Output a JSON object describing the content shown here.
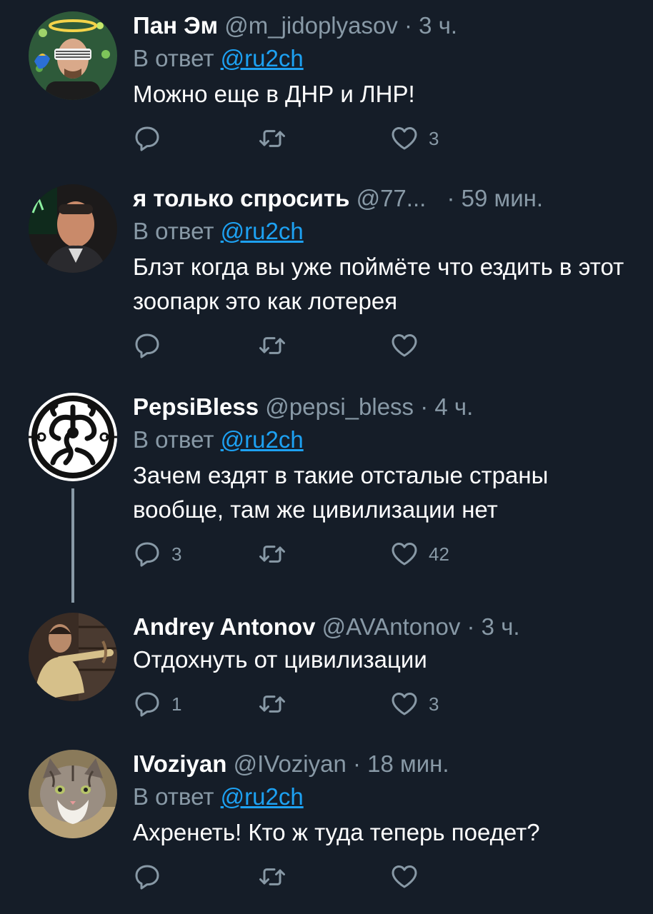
{
  "colors": {
    "background": "#151d28",
    "secondary_text": "#8899a6",
    "link": "#1da1f2",
    "primary_text": "#ffffff"
  },
  "tweets": [
    {
      "name": "Пан Эм",
      "handle": "@m_jidoplyasov",
      "time": "· 3 ч.",
      "reply_prefix": "В ответ",
      "reply_to": "@ru2ch",
      "text": "Можно еще в ДНР и ЛНР!",
      "replies": "",
      "likes": "3"
    },
    {
      "name": "я только спросить",
      "handle": "@77...",
      "time": "· 59 мин.",
      "reply_prefix": "В ответ",
      "reply_to": "@ru2ch",
      "text": "Блэт когда вы уже поймёте что ездить в этот зоопарк это как лотерея",
      "replies": "",
      "likes": ""
    },
    {
      "name": "PepsiBless",
      "handle": "@pepsi_bless",
      "time": "· 4 ч.",
      "reply_prefix": "В ответ",
      "reply_to": "@ru2ch",
      "text": "Зачем ездят в такие отсталые страны вообще, там же цивилизации нет",
      "replies": "3",
      "likes": "42"
    },
    {
      "name": "Andrey Antonov",
      "handle": "@AVAntonov",
      "time": "· 3 ч.",
      "text": "Отдохнуть от цивилизации",
      "replies": "1",
      "likes": "3"
    },
    {
      "name": "IVoziyan",
      "handle": "@IVoziyan",
      "time": "· 18 мин.",
      "reply_prefix": "В ответ",
      "reply_to": "@ru2ch",
      "text": "Ахренеть! Кто ж туда теперь поедет?",
      "replies": "",
      "likes": ""
    }
  ]
}
